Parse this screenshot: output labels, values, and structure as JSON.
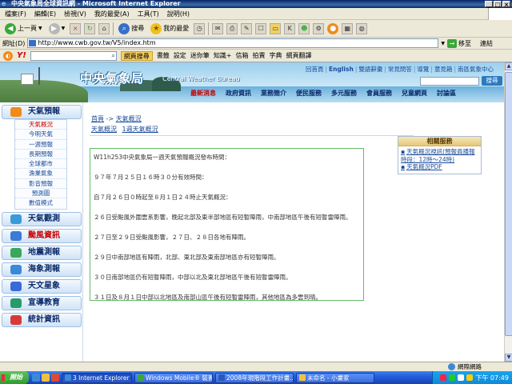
{
  "window": {
    "title": "中央氣象局全球資訊網 - Microsoft Internet Explorer"
  },
  "menu": [
    "檔案(F)",
    "編輯(E)",
    "檢視(V)",
    "我的最愛(A)",
    "工具(T)",
    "說明(H)"
  ],
  "toolbar": {
    "back": "上一頁",
    "search": "搜尋",
    "favorites": "我的最愛"
  },
  "address": {
    "label": "網址(D)",
    "url": "http://www.cwb.gov.tw/V5/index.htm",
    "go": "移至",
    "links": "連結"
  },
  "yahoo": {
    "logo": "Y!",
    "search_btn": "網頁搜尋",
    "items": [
      "書籤",
      "設定",
      "迷你筆",
      "知識+",
      "信箱",
      "拍賣",
      "字典",
      "網頁翻譯"
    ]
  },
  "site": {
    "logo_cn": "中央氣象局",
    "logo_en": "Central Weather Bureau",
    "toplinks": [
      "回首頁",
      "English",
      "雙語辭彙",
      "常見問答",
      "導覽",
      "意見箱",
      "南區氣象中心"
    ],
    "search_btn": "搜尋",
    "nav": [
      "最新消息",
      "政府資訊",
      "業務簡介",
      "便民服務",
      "多元服務",
      "會員服務",
      "兒童網頁",
      "討論區"
    ]
  },
  "sidebar": {
    "sections": [
      {
        "label": "天氣預報",
        "color": "#f08a1a"
      },
      {
        "label": "天氣觀測",
        "color": "#3a9ad8"
      },
      {
        "label": "颱風資訊",
        "color": "#3a7ad8"
      },
      {
        "label": "地震測報",
        "color": "#3aa85a"
      },
      {
        "label": "海象測報",
        "color": "#3a8ad8"
      },
      {
        "label": "天文星象",
        "color": "#3a6ad8"
      },
      {
        "label": "宣導教育",
        "color": "#2a9a6a"
      },
      {
        "label": "統計資訊",
        "color": "#d83a3a"
      }
    ],
    "forecast_items": [
      "天氣概況",
      "今明天氣",
      "一週預報",
      "長期預報",
      "全球都市",
      "漁業氣象",
      "影音預報",
      "預測圖",
      "數值模式"
    ]
  },
  "content": {
    "breadcrumb_home": "首頁",
    "breadcrumb_sep": "->",
    "breadcrumb_current": "天氣概況",
    "subnav": [
      "天氣概況",
      "1週天氣概況"
    ],
    "forecast_lines": [
      "W11h253中央氣象局一週天氣預報概況發布時間：",
      "９７年７月２５日１６時３０分有效時間：",
      "自７月２６日０時起至８月１日２４時止天氣概況：",
      "２６日受颱風外圍雲系影響，晚起北部及東半部地區有短暫陣雨，中南部地區午後有短暫雷陣雨。",
      "２７日至２９日受颱風影響，２７日、２８日各地有陣雨。",
      "２９日中南部地區有陣雨，北部、東北部及東南部地區亦有短暫陣雨。",
      "３０日南部地區仍有短暫陣雨，中部以北及東北部地區午後有短暫雷陣雨。",
      "３１日及８月１日中部以北地區及南部山區午後有短暫雷陣雨，其他地區為多雲到晴。"
    ],
    "related": {
      "title": "相關服務",
      "items": [
        "天氣概況視訊(預報員播報時段：12時～24時)",
        "天氣概況PDF"
      ]
    }
  },
  "statusbar": {
    "zone": "網際網路"
  },
  "taskbar": {
    "start": "開始",
    "tasks": [
      "3 Internet Explorer",
      "Windows Mobile® 裝置...",
      "2008年現階段工作計畫...",
      "未命名 - 小畫家"
    ],
    "clock": "下午 07:49"
  }
}
